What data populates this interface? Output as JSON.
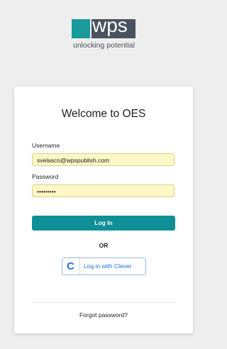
{
  "brand": {
    "logo_text": "wps",
    "tagline": "unlocking potential",
    "colors": {
      "teal": "#1a9a9a",
      "slate": "#49535f"
    }
  },
  "login": {
    "title": "Welcome to OES",
    "username_label": "Username",
    "username_value": "svelasco@wpspublish.com",
    "password_label": "Password",
    "password_value": "•••••••••",
    "login_button": "Log In",
    "or_text": "OR",
    "clever_icon": "C",
    "clever_button": "Log in with Clever",
    "forgot_link": "Forgot password?"
  },
  "colors": {
    "primary_button": "#0f8f96",
    "clever_blue": "#1e6fd9",
    "autofill_yellow": "#fcf7c7"
  }
}
